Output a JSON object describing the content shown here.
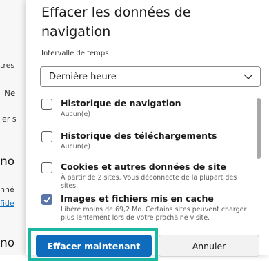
{
  "background": {
    "fragments": [
      "tres",
      "Ne",
      "ier s",
      "no",
      "nné",
      "fide",
      "no"
    ]
  },
  "dialog": {
    "title": "Effacer les données de navigation",
    "time_range": {
      "label": "Intervalle de temps",
      "selected": "Dernière heure"
    },
    "options": [
      {
        "title": "Historique de navigation",
        "description": "Aucun(e)",
        "checked": false
      },
      {
        "title": "Historique des téléchargements",
        "description": "Aucun(e)",
        "checked": false
      },
      {
        "title": "Cookies et autres données de site",
        "description": "À partir de 2 sites. Vous déconnecte de la plupart des sites.",
        "checked": false
      },
      {
        "title": "Images et fichiers mis en cache",
        "description": "Libère moins de 69,2 Mo. Certains sites peuvent charger plus lentement lors de votre prochaine visite.",
        "checked": true
      }
    ],
    "buttons": {
      "clear": "Effacer maintenant",
      "cancel": "Annuler"
    }
  },
  "colors": {
    "accent": "#0f6cbd",
    "highlight": "#1bb7a3",
    "checked": "#5a76a8"
  }
}
